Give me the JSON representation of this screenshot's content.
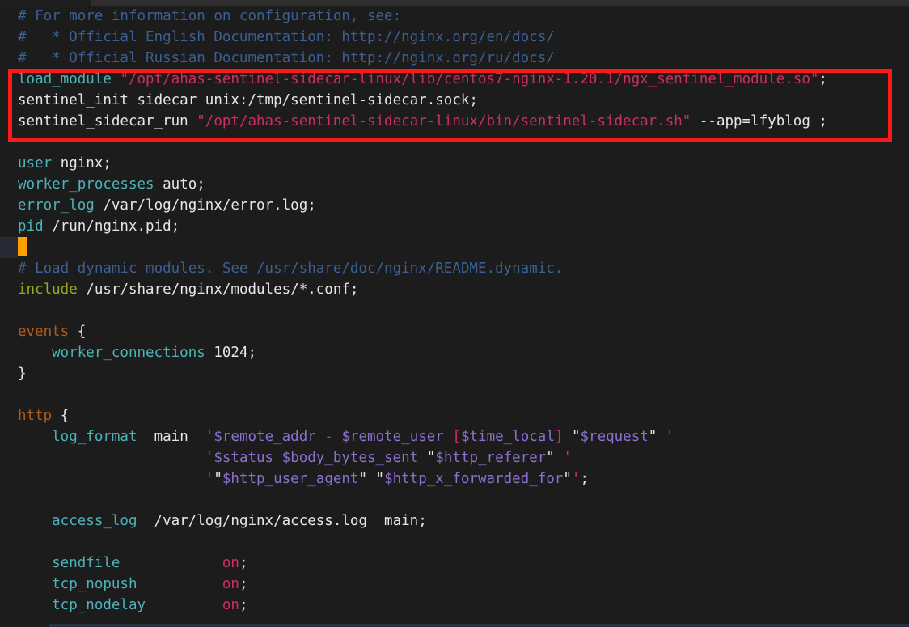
{
  "window": {
    "app": "code-editor",
    "theme_background": "#1c1c1c"
  },
  "colors": {
    "comment": "#3c5f94",
    "directive": "#4cb3b8",
    "block_keyword": "#b35c17",
    "string": "#cf2e5e",
    "variable": "#8d6fd1",
    "include_keyword": "#98a81e",
    "plain_text": "#e6e6e6",
    "cursor": "#ffa000",
    "annotation_box": "#ff1a1a",
    "active_line_gutter": "#282a36"
  },
  "annotation": {
    "type": "red-rectangle-highlight",
    "covers_lines": [
      4,
      5,
      6
    ],
    "label": ""
  },
  "cursor": {
    "line": 11,
    "column": 1,
    "glyph": "block"
  },
  "code": {
    "language": "nginx-conf",
    "lines": [
      {
        "id": 1,
        "tokens": [
          {
            "t": "# For more information on configuration, see:",
            "c": "comment"
          }
        ]
      },
      {
        "id": 2,
        "tokens": [
          {
            "t": "#   * Official English Documentation: http://nginx.org/en/docs/",
            "c": "comment"
          }
        ]
      },
      {
        "id": 3,
        "tokens": [
          {
            "t": "#   * Official Russian Documentation: http://nginx.org/ru/docs/",
            "c": "comment"
          }
        ]
      },
      {
        "id": 4,
        "tokens": [
          {
            "t": "load_module",
            "c": "directive"
          },
          {
            "t": " ",
            "c": "plain"
          },
          {
            "t": "\"/opt/ahas-sentinel-sidecar-linux/lib/centos7-nginx-1.20.1/ngx_sentinel_module.so\"",
            "c": "string"
          },
          {
            "t": ";",
            "c": "punct"
          }
        ]
      },
      {
        "id": 5,
        "tokens": [
          {
            "t": "sentinel_init sidecar unix:/tmp/sentinel-sidecar.sock;",
            "c": "plain"
          }
        ]
      },
      {
        "id": 6,
        "tokens": [
          {
            "t": "sentinel_sidecar_run ",
            "c": "plain"
          },
          {
            "t": "\"/opt/ahas-sentinel-sidecar-linux/bin/sentinel-sidecar.sh\"",
            "c": "string"
          },
          {
            "t": " --app=lfyblog ;",
            "c": "plain"
          }
        ]
      },
      {
        "id": 7,
        "tokens": []
      },
      {
        "id": 8,
        "tokens": [
          {
            "t": "user",
            "c": "directive"
          },
          {
            "t": " nginx;",
            "c": "plain"
          }
        ]
      },
      {
        "id": 9,
        "tokens": [
          {
            "t": "worker_processes",
            "c": "directive"
          },
          {
            "t": " auto;",
            "c": "plain"
          }
        ]
      },
      {
        "id": 10,
        "tokens": [
          {
            "t": "error_log",
            "c": "directive"
          },
          {
            "t": " /var/log/nginx/error.log;",
            "c": "plain"
          }
        ]
      },
      {
        "id": 11,
        "tokens": [
          {
            "t": "pid",
            "c": "directive"
          },
          {
            "t": " /run/nginx.pid;",
            "c": "plain"
          }
        ]
      },
      {
        "id": 12,
        "tokens": [],
        "cursor": true
      },
      {
        "id": 13,
        "tokens": [
          {
            "t": "# Load dynamic modules. See /usr/share/doc/nginx/README.dynamic.",
            "c": "comment"
          }
        ]
      },
      {
        "id": 14,
        "tokens": [
          {
            "t": "include",
            "c": "include"
          },
          {
            "t": " /usr/share/nginx/modules/*.conf;",
            "c": "plain"
          }
        ]
      },
      {
        "id": 15,
        "tokens": []
      },
      {
        "id": 16,
        "tokens": [
          {
            "t": "events",
            "c": "block"
          },
          {
            "t": " {",
            "c": "plain"
          }
        ]
      },
      {
        "id": 17,
        "tokens": [
          {
            "t": "    worker_connections",
            "c": "directive"
          },
          {
            "t": " 1024;",
            "c": "plain"
          }
        ]
      },
      {
        "id": 18,
        "tokens": [
          {
            "t": "}",
            "c": "plain"
          }
        ]
      },
      {
        "id": 19,
        "tokens": []
      },
      {
        "id": 20,
        "tokens": [
          {
            "t": "http",
            "c": "block"
          },
          {
            "t": " {",
            "c": "plain"
          }
        ]
      },
      {
        "id": 21,
        "tokens": [
          {
            "t": "    log_format",
            "c": "directive"
          },
          {
            "t": "  main  ",
            "c": "plain"
          },
          {
            "t": "'",
            "c": "string"
          },
          {
            "t": "$remote_addr",
            "c": "variable"
          },
          {
            "t": " ",
            "c": "plain"
          },
          {
            "t": "-",
            "c": "string"
          },
          {
            "t": " ",
            "c": "plain"
          },
          {
            "t": "$remote_user",
            "c": "variable"
          },
          {
            "t": " ",
            "c": "plain"
          },
          {
            "t": "[",
            "c": "string"
          },
          {
            "t": "$time_local",
            "c": "variable"
          },
          {
            "t": "]",
            "c": "string"
          },
          {
            "t": " \"",
            "c": "plain"
          },
          {
            "t": "$request",
            "c": "variable"
          },
          {
            "t": "\" ",
            "c": "plain"
          },
          {
            "t": "'",
            "c": "string"
          }
        ]
      },
      {
        "id": 22,
        "tokens": [
          {
            "t": "                      ",
            "c": "plain"
          },
          {
            "t": "'",
            "c": "string"
          },
          {
            "t": "$status",
            "c": "variable"
          },
          {
            "t": " ",
            "c": "plain"
          },
          {
            "t": "$body_bytes_sent",
            "c": "variable"
          },
          {
            "t": " \"",
            "c": "plain"
          },
          {
            "t": "$http_referer",
            "c": "variable"
          },
          {
            "t": "\" ",
            "c": "plain"
          },
          {
            "t": "'",
            "c": "string"
          }
        ]
      },
      {
        "id": 23,
        "tokens": [
          {
            "t": "                      ",
            "c": "plain"
          },
          {
            "t": "'",
            "c": "string"
          },
          {
            "t": "\"",
            "c": "plain"
          },
          {
            "t": "$http_user_agent",
            "c": "variable"
          },
          {
            "t": "\" \"",
            "c": "plain"
          },
          {
            "t": "$http_x_forwarded_for",
            "c": "variable"
          },
          {
            "t": "\"",
            "c": "plain"
          },
          {
            "t": "'",
            "c": "string"
          },
          {
            "t": ";",
            "c": "punct"
          }
        ]
      },
      {
        "id": 24,
        "tokens": []
      },
      {
        "id": 25,
        "tokens": [
          {
            "t": "    access_log",
            "c": "directive"
          },
          {
            "t": "  /var/log/nginx/access.log  main;",
            "c": "plain"
          }
        ]
      },
      {
        "id": 26,
        "tokens": []
      },
      {
        "id": 27,
        "tokens": [
          {
            "t": "    sendfile",
            "c": "directive"
          },
          {
            "t": "            ",
            "c": "plain"
          },
          {
            "t": "on",
            "c": "value"
          },
          {
            "t": ";",
            "c": "punct"
          }
        ]
      },
      {
        "id": 28,
        "tokens": [
          {
            "t": "    tcp_nopush",
            "c": "directive"
          },
          {
            "t": "          ",
            "c": "plain"
          },
          {
            "t": "on",
            "c": "value"
          },
          {
            "t": ";",
            "c": "punct"
          }
        ]
      },
      {
        "id": 29,
        "tokens": [
          {
            "t": "    tcp_nodelay",
            "c": "directive"
          },
          {
            "t": "         ",
            "c": "plain"
          },
          {
            "t": "on",
            "c": "value"
          },
          {
            "t": ";",
            "c": "punct"
          }
        ]
      }
    ]
  }
}
